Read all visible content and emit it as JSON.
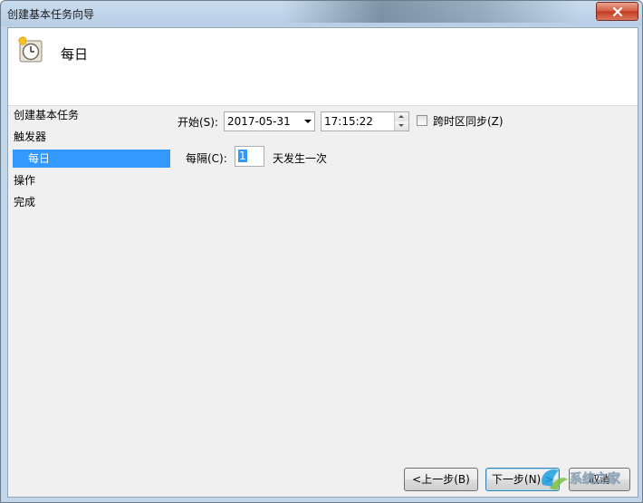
{
  "window": {
    "title": "创建基本任务向导"
  },
  "header": {
    "title": "每日"
  },
  "nav": {
    "items": [
      {
        "label": "创建基本任务",
        "selected": false
      },
      {
        "label": "触发器",
        "selected": false
      },
      {
        "label": "每日",
        "selected": true
      },
      {
        "label": "操作",
        "selected": false
      },
      {
        "label": "完成",
        "selected": false
      }
    ]
  },
  "form": {
    "start_label": "开始(S):",
    "start_date": "2017-05-31",
    "start_time": "17:15:22",
    "sync_timezone_label": "跨时区同步(Z)",
    "sync_timezone_checked": false,
    "recur_label": "每隔(C):",
    "recur_value": "1",
    "recur_suffix": "天发生一次"
  },
  "buttons": {
    "back": "<上一步(B)",
    "next": "下一步(N) >",
    "cancel": "取消"
  },
  "watermark": "系统之家",
  "colors": {
    "selection": "#3399ff",
    "close": "#c2391e",
    "title_bg": "#c2d6ea"
  }
}
